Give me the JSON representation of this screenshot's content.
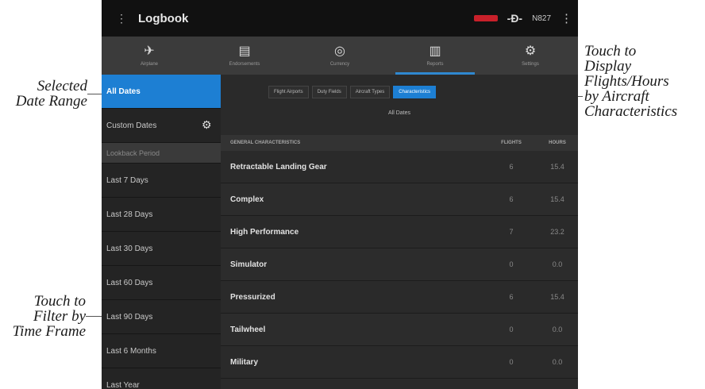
{
  "callouts": {
    "selected_date_range": [
      "Selected",
      "Date Range"
    ],
    "display_flights": [
      "Touch to",
      "Display",
      "Flights/Hours",
      "by Aircraft",
      "Characteristics"
    ],
    "filter_time": [
      "Touch to",
      "Filter by",
      "Time Frame"
    ]
  },
  "topbar": {
    "menu_icon": "menu-icon",
    "title": "Logbook",
    "tail_number": "N827",
    "badge_color": "#c8202a"
  },
  "tabs": [
    {
      "label": "Airplane",
      "icon": "airplane-icon"
    },
    {
      "label": "Endorsements",
      "icon": "document-icon"
    },
    {
      "label": "Currency",
      "icon": "compass-icon"
    },
    {
      "label": "Reports",
      "icon": "chart-icon"
    },
    {
      "label": "Settings",
      "icon": "gear-icon"
    }
  ],
  "sidebar": {
    "items": [
      {
        "label": "All Dates",
        "selected": true
      },
      {
        "label": "Custom Dates",
        "selected": false
      },
      {
        "label": "Lookback Period",
        "header": true
      },
      {
        "label": "Last 7 Days",
        "selected": false
      },
      {
        "label": "Last 28 Days",
        "selected": false
      },
      {
        "label": "Last 30 Days",
        "selected": false
      },
      {
        "label": "Last 60 Days",
        "selected": false
      },
      {
        "label": "Last 90 Days",
        "selected": false
      },
      {
        "label": "Last 6 Months",
        "selected": false
      },
      {
        "label": "Last Year",
        "selected": false
      }
    ]
  },
  "segments": [
    {
      "label": "Flight Airports"
    },
    {
      "label": "Duty Fields"
    },
    {
      "label": "Aircraft Types"
    },
    {
      "label": "Characteristics",
      "active": true
    }
  ],
  "range_label": "All Dates",
  "table": {
    "headers": {
      "name": "GENERAL CHARACTERISTICS",
      "flights": "FLIGHTS",
      "hours": "HOURS"
    },
    "rows": [
      {
        "name": "Retractable Landing Gear",
        "flights": "6",
        "hours": "15.4"
      },
      {
        "name": "Complex",
        "flights": "6",
        "hours": "15.4"
      },
      {
        "name": "High Performance",
        "flights": "7",
        "hours": "23.2"
      },
      {
        "name": "Simulator",
        "flights": "0",
        "hours": "0.0"
      },
      {
        "name": "Pressurized",
        "flights": "6",
        "hours": "15.4"
      },
      {
        "name": "Tailwheel",
        "flights": "0",
        "hours": "0.0"
      },
      {
        "name": "Military",
        "flights": "0",
        "hours": "0.0"
      }
    ]
  },
  "colors": {
    "accent": "#1d7fd3",
    "background": "#1d1d1d"
  }
}
